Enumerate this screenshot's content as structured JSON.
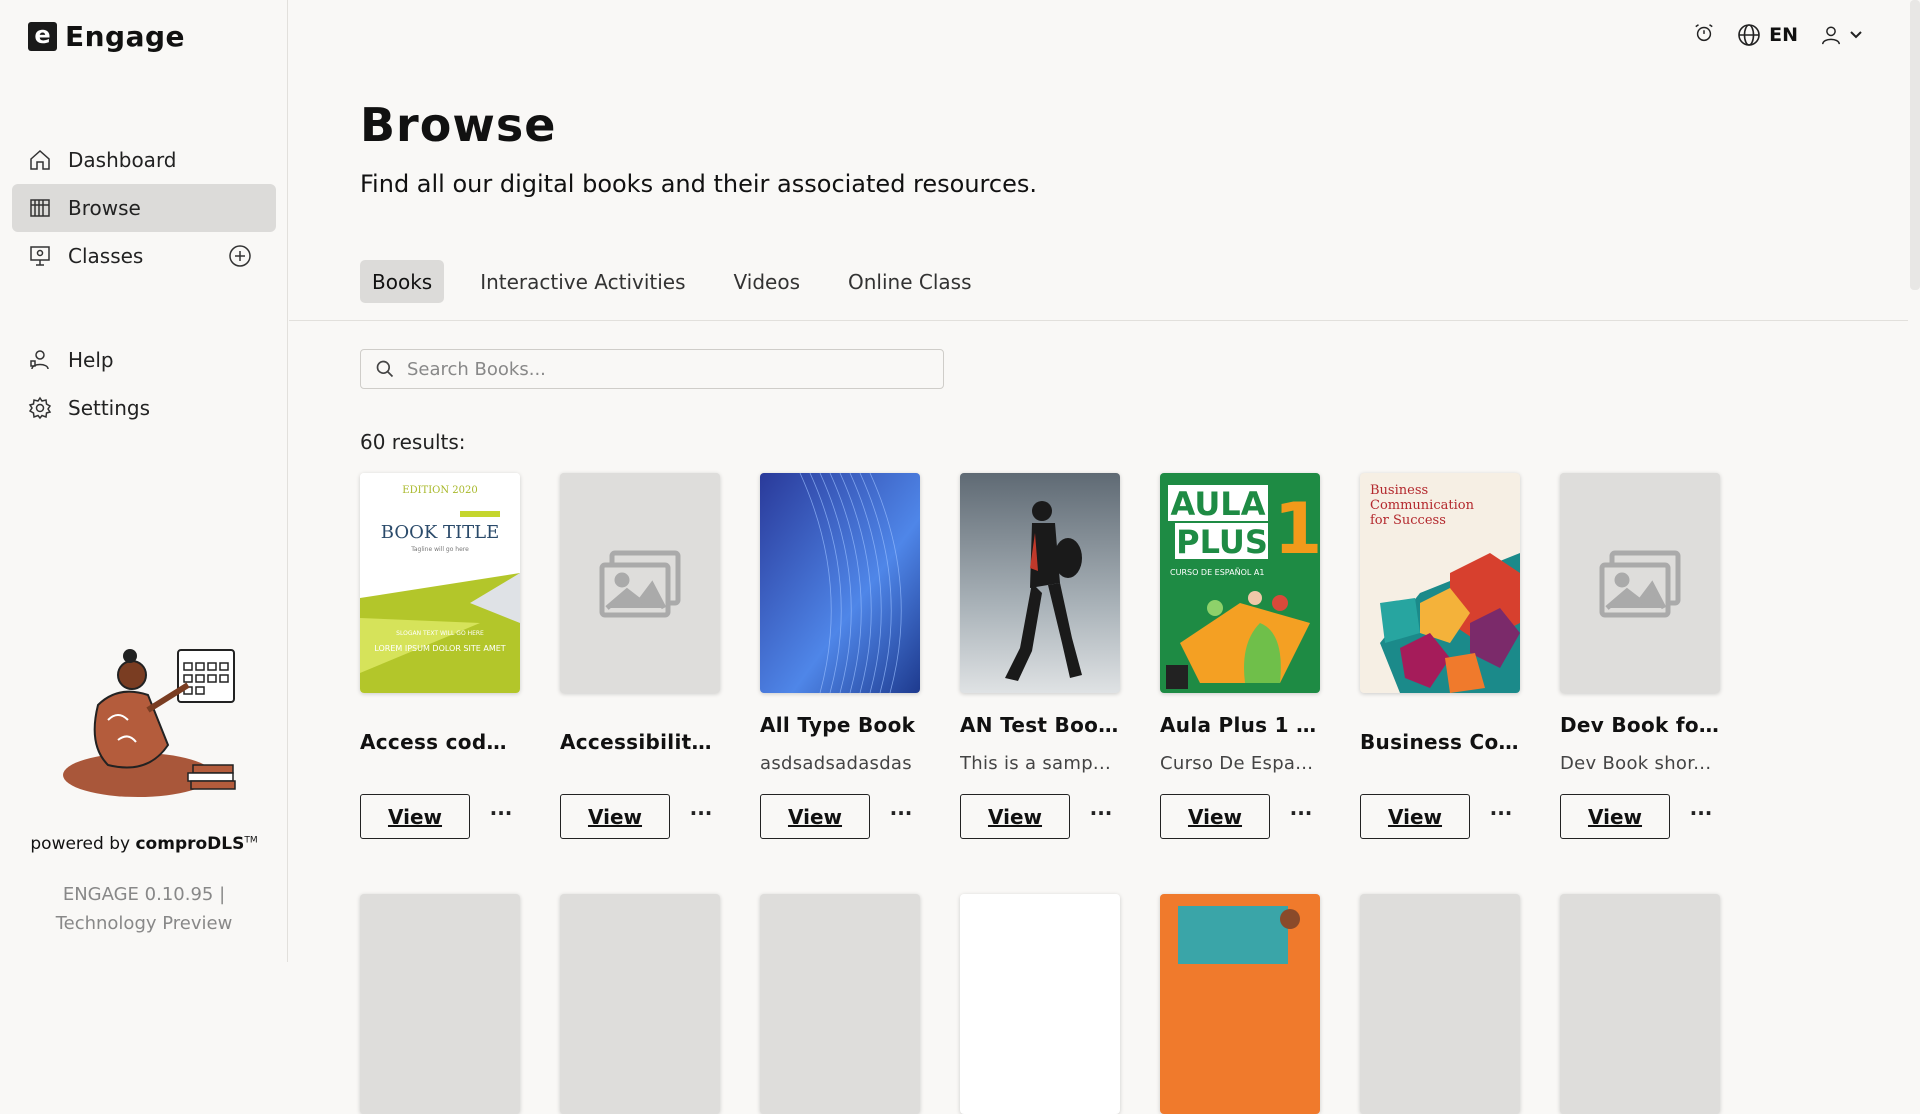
{
  "app": {
    "logo_letter": "e",
    "name": "Engage"
  },
  "sidebar": {
    "items": [
      {
        "label": "Dashboard",
        "icon": "home-icon"
      },
      {
        "label": "Browse",
        "icon": "library-icon",
        "active": true
      },
      {
        "label": "Classes",
        "icon": "classroom-icon"
      },
      {
        "label": "Help",
        "icon": "help-icon"
      },
      {
        "label": "Settings",
        "icon": "gear-icon"
      }
    ],
    "powered_prefix": "powered by ",
    "powered_brand": "comproDLS",
    "powered_tm": "TM",
    "version_line1": "ENGAGE 0.10.95 |",
    "version_line2": "Technology Preview"
  },
  "header": {
    "language": "EN",
    "icons": [
      "alarm-icon",
      "globe-icon",
      "user-icon",
      "chevron-down-icon"
    ]
  },
  "page": {
    "title": "Browse",
    "subtitle": "Find all our digital books and their associated resources.",
    "tabs": [
      "Books",
      "Interactive Activities",
      "Videos",
      "Online Class"
    ],
    "active_tab": "Books",
    "search_placeholder": "Search Books...",
    "results": "60 results:"
  },
  "books": [
    {
      "title": "Access code ...",
      "desc": "",
      "cover": "book-title-cover"
    },
    {
      "title": "Accessibility...",
      "desc": "",
      "cover": "placeholder"
    },
    {
      "title": "All Type Book",
      "desc": "asdsadsadasdas",
      "cover": "blue-waves"
    },
    {
      "title": "AN Test Boo...",
      "desc": "This is a samp...",
      "cover": "hiker-photo"
    },
    {
      "title": "Aula Plus 1 (...",
      "desc": "Curso De Espa...",
      "cover": "aula-plus"
    },
    {
      "title": "Business Co...",
      "desc": "",
      "cover": "business-comm"
    },
    {
      "title": "Dev Book for...",
      "desc": "Dev Book shor...",
      "cover": "placeholder"
    }
  ],
  "book_cover_text": {
    "edition": "EDITION 2020",
    "book_title": "BOOK TITLE",
    "tagline": "Tagline will go here",
    "slogan": "SLOGAN TEXT WILL GO HERE",
    "lorem": "LOREM IPSUM DOLOR SITE AMET",
    "aula": "AULA",
    "plus": "PLUS",
    "aula_num": "1",
    "aula_sub": "CURSO DE ESPAÑOL A1",
    "business": "Business Communication for Success"
  },
  "view_label": "View",
  "more_label": "···"
}
